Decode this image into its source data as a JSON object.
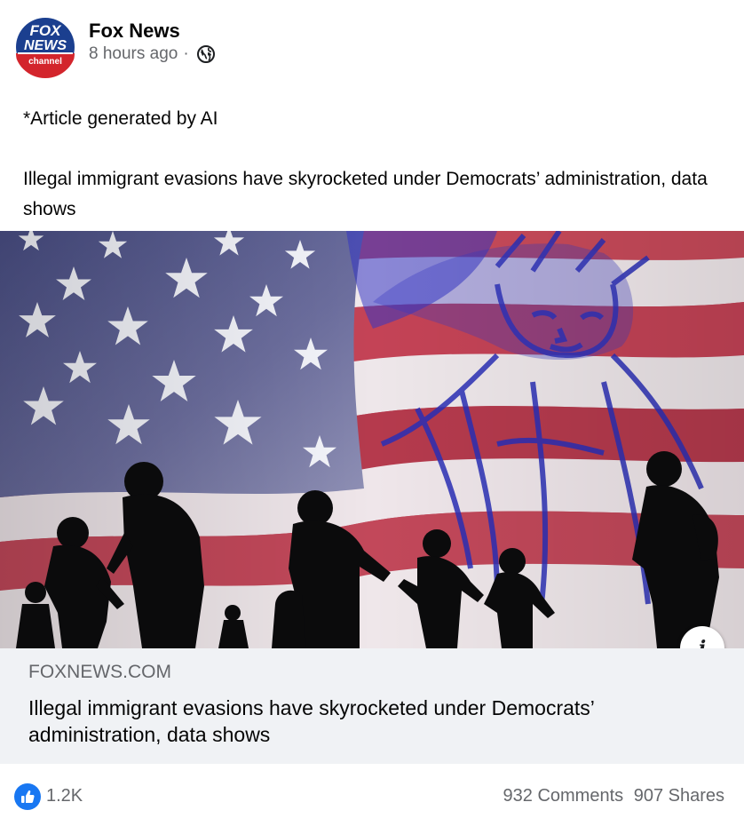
{
  "post": {
    "page_name": "Fox News",
    "timestamp": "8 hours ago",
    "separator": "·",
    "privacy_icon": "globe-icon",
    "logo": {
      "line1": "FOX",
      "line2": "NEWS",
      "line3": "channel"
    },
    "text_line1": "*Article generated by AI",
    "text_line2": "Illegal immigrant evasions have skyrocketed under Democrats’ administration, data shows"
  },
  "link": {
    "domain": "FOXNEWS.COM",
    "title": "Illegal immigrant evasions have skyrocketed under Democrats’ administration, data shows",
    "info_label": "i"
  },
  "reactions": {
    "like_count": "1.2K",
    "comments": "932 Comments",
    "shares": "907 Shares"
  },
  "colors": {
    "brand_blue": "#1877f2",
    "fox_blue": "#1b3f8f",
    "fox_red": "#d3252c",
    "link_bg": "#f0f2f5"
  }
}
